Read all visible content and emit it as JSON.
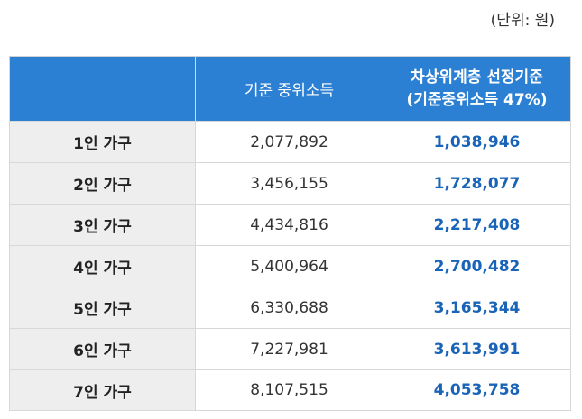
{
  "unit_note": "(단위: 원)",
  "header": {
    "col1": "",
    "col2": "기준 중위소득",
    "col3_line1": "차상위계층 선정기준",
    "col3_line2": "(기준중위소득 47%)"
  },
  "rows": [
    {
      "household": "1인 가구",
      "median": "2,077,892",
      "threshold": "1,038,946"
    },
    {
      "household": "2인 가구",
      "median": "3,456,155",
      "threshold": "1,728,077"
    },
    {
      "household": "3인 가구",
      "median": "4,434,816",
      "threshold": "2,217,408"
    },
    {
      "household": "4인 가구",
      "median": "5,400,964",
      "threshold": "2,700,482"
    },
    {
      "household": "5인 가구",
      "median": "6,330,688",
      "threshold": "3,165,344"
    },
    {
      "household": "6인 가구",
      "median": "7,227,981",
      "threshold": "3,613,991"
    },
    {
      "household": "7인 가구",
      "median": "8,107,515",
      "threshold": "4,053,758"
    }
  ],
  "colors": {
    "header_bg": "#2c80d3",
    "threshold_text": "#1a64b8",
    "label_bg": "#eeeeee"
  }
}
